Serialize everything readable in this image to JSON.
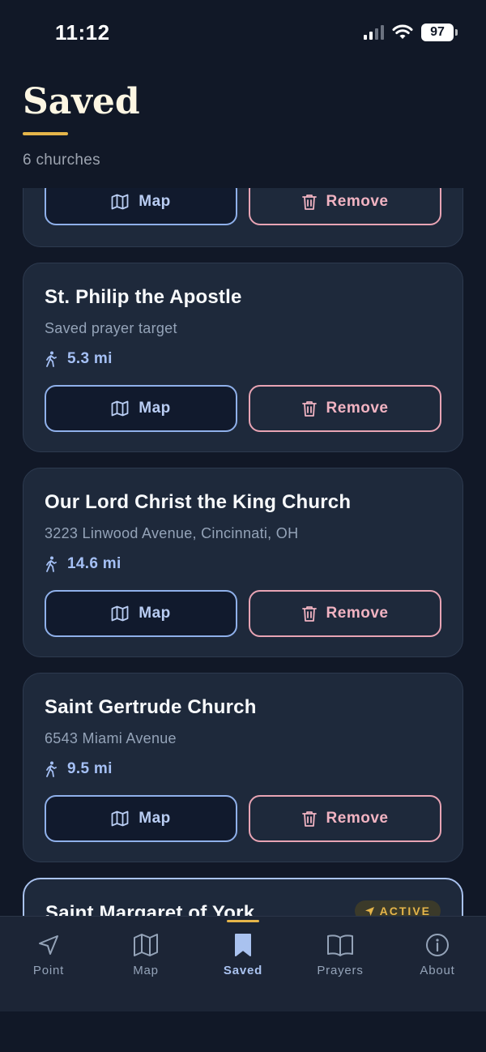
{
  "status_bar": {
    "time": "11:12",
    "battery": "97"
  },
  "header": {
    "title": "Saved",
    "count": "6 churches"
  },
  "buttons": {
    "map_label": "Map",
    "remove_label": "Remove"
  },
  "churches": [
    {
      "name": "",
      "subtitle": "",
      "distance": ""
    },
    {
      "name": "St. Philip the Apostle",
      "subtitle": "Saved prayer target",
      "distance": "5.3 mi"
    },
    {
      "name": "Our Lord Christ the King Church",
      "subtitle": "3223 Linwood Avenue, Cincinnati, OH",
      "distance": "14.6 mi"
    },
    {
      "name": "Saint Gertrude Church",
      "subtitle": "6543 Miami Avenue",
      "distance": "9.5 mi"
    },
    {
      "name": "Saint Margaret of York",
      "badge": "ACTIVE"
    }
  ],
  "tabs": [
    {
      "label": "Point",
      "icon": "navigation-arrow-icon"
    },
    {
      "label": "Map",
      "icon": "map-icon"
    },
    {
      "label": "Saved",
      "icon": "bookmark-icon",
      "selected": true
    },
    {
      "label": "Prayers",
      "icon": "book-icon"
    },
    {
      "label": "About",
      "icon": "info-icon"
    }
  ],
  "colors": {
    "background": "#111827",
    "card": "#1e293b",
    "accent_gold": "#e5b54a",
    "accent_blue": "#a9c2ef",
    "remove_pink": "#f1b3c2"
  }
}
